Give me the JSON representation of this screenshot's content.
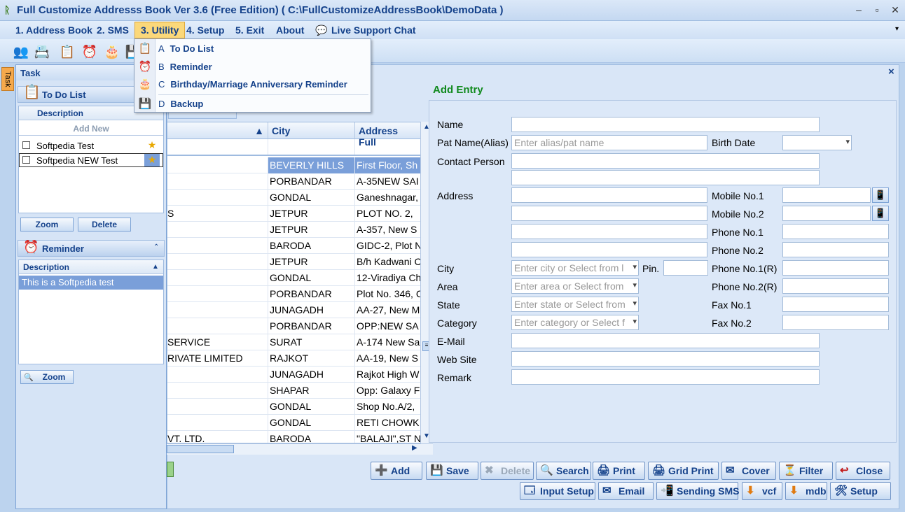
{
  "window": {
    "title": "Full Customize Addresss Book Ver 3.6 (Free Edition)     ( C:\\FullCustomizeAddressBook\\DemoData )",
    "minimize": "‒",
    "restore": "▫",
    "close": "✕"
  },
  "menu": {
    "items": [
      "1. Address Book",
      "2. SMS",
      "3. Utility",
      "4. Setup",
      "5. Exit",
      "About",
      "Live Support Chat"
    ],
    "utility_dropdown": [
      {
        "key": "A",
        "label": "To Do List",
        "icon": "todo-icon"
      },
      {
        "key": "B",
        "label": "Reminder",
        "icon": "alarm-clock-icon"
      },
      {
        "key": "C",
        "label": "Birthday/Marriage Anniversary Reminder",
        "icon": "cake-icon"
      },
      {
        "key": "D",
        "label": "Backup",
        "icon": "backup-icon"
      }
    ]
  },
  "toolbar": {
    "icons": [
      "contacts-icon",
      "user-card-icon",
      "todo-icon",
      "alarm-clock-icon",
      "cake-icon",
      "backup-icon"
    ]
  },
  "task_panel": {
    "tab_label": "Task",
    "title": "Task",
    "todo": {
      "header": "To Do List",
      "column": "Description",
      "add_new": "Add New",
      "items": [
        "Softpedia Test",
        "Softpedia NEW Test"
      ],
      "zoom": "Zoom",
      "delete": "Delete"
    },
    "reminder": {
      "header": "Reminder",
      "column": "Description",
      "items": [
        "This is a Softpedia test"
      ],
      "zoom": "Zoom"
    }
  },
  "grid": {
    "columns": [
      "City",
      "Address Full"
    ],
    "rows": [
      [
        "",
        "BEVERLY HILLS",
        "First Floor, Sh"
      ],
      [
        "",
        "PORBANDAR",
        "A-35NEW SAI"
      ],
      [
        "",
        "GONDAL",
        "Ganeshnagar,"
      ],
      [
        "S",
        "JETPUR",
        "PLOT NO. 2,"
      ],
      [
        "",
        "JETPUR",
        "A-357, New S"
      ],
      [
        "",
        "BARODA",
        "GIDC-2, Plot N"
      ],
      [
        "",
        "JETPUR",
        "B/h Kadwani C"
      ],
      [
        "",
        "GONDAL",
        "12-Viradiya Ch"
      ],
      [
        "",
        "PORBANDAR",
        "Plot No. 346, C"
      ],
      [
        "",
        "JUNAGADH",
        "AA-27, New M"
      ],
      [
        "",
        "PORBANDAR",
        "OPP:NEW SA"
      ],
      [
        "SERVICE",
        "SURAT",
        "A-174 New Sa"
      ],
      [
        "RIVATE LIMITED",
        "RAJKOT",
        "AA-19, New S"
      ],
      [
        "",
        "JUNAGADH",
        "Rajkot High W"
      ],
      [
        "",
        "SHAPAR",
        "Opp: Galaxy F"
      ],
      [
        "",
        "GONDAL",
        "Shop No.A/2,"
      ],
      [
        "",
        "GONDAL",
        "RETI CHOWK"
      ],
      [
        "VT. LTD.",
        "BARODA",
        "\"BALAJI\",ST N"
      ]
    ]
  },
  "form": {
    "heading": "Add Entry",
    "close": "×",
    "labels": {
      "name": "Name",
      "pat_name": "Pat Name(Alias)",
      "birth_date": "Birth Date",
      "contact_person": "Contact Person",
      "address": "Address",
      "mobile1": "Mobile No.1",
      "mobile2": "Mobile No.2",
      "phone1": "Phone No.1",
      "phone2": "Phone No.2",
      "city": "City",
      "pin": "Pin.",
      "phone1r": "Phone No.1(R)",
      "area": "Area",
      "phone2r": "Phone No.2(R)",
      "state": "State",
      "fax1": "Fax No.1",
      "category": "Category",
      "fax2": "Fax No.2",
      "email": "E-Mail",
      "website": "Web Site",
      "remark": "Remark"
    },
    "placeholders": {
      "pat_name": "Enter alias/pat name",
      "city": "Enter city or Select from l",
      "area": "Enter area or Select from",
      "state": "Enter state or Select from",
      "category": "Enter category or Select f"
    }
  },
  "buttons": {
    "row1": [
      {
        "label": "Add",
        "icon": "add-icon",
        "enabled": true
      },
      {
        "label": "Save",
        "icon": "save-icon",
        "enabled": true
      },
      {
        "label": "Delete",
        "icon": "delete-icon",
        "enabled": false
      },
      {
        "label": "Search",
        "icon": "search-icon",
        "enabled": true
      },
      {
        "label": "Print",
        "icon": "print-icon",
        "enabled": true
      },
      {
        "label": "Grid Print",
        "icon": "grid-print-icon",
        "enabled": true
      },
      {
        "label": "Cover",
        "icon": "cover-icon",
        "enabled": true
      },
      {
        "label": "Filter",
        "icon": "filter-icon",
        "enabled": true
      },
      {
        "label": "Close",
        "icon": "close-icon",
        "enabled": true
      }
    ],
    "row2": [
      {
        "label": "Input Setup",
        "icon": "input-setup-icon"
      },
      {
        "label": "Email",
        "icon": "email-icon"
      },
      {
        "label": "Sending SMS",
        "icon": "sms-icon"
      },
      {
        "label": "vcf",
        "icon": "vcf-icon"
      },
      {
        "label": "mdb",
        "icon": "mdb-icon"
      },
      {
        "label": "Setup",
        "icon": "setup-icon"
      }
    ]
  }
}
